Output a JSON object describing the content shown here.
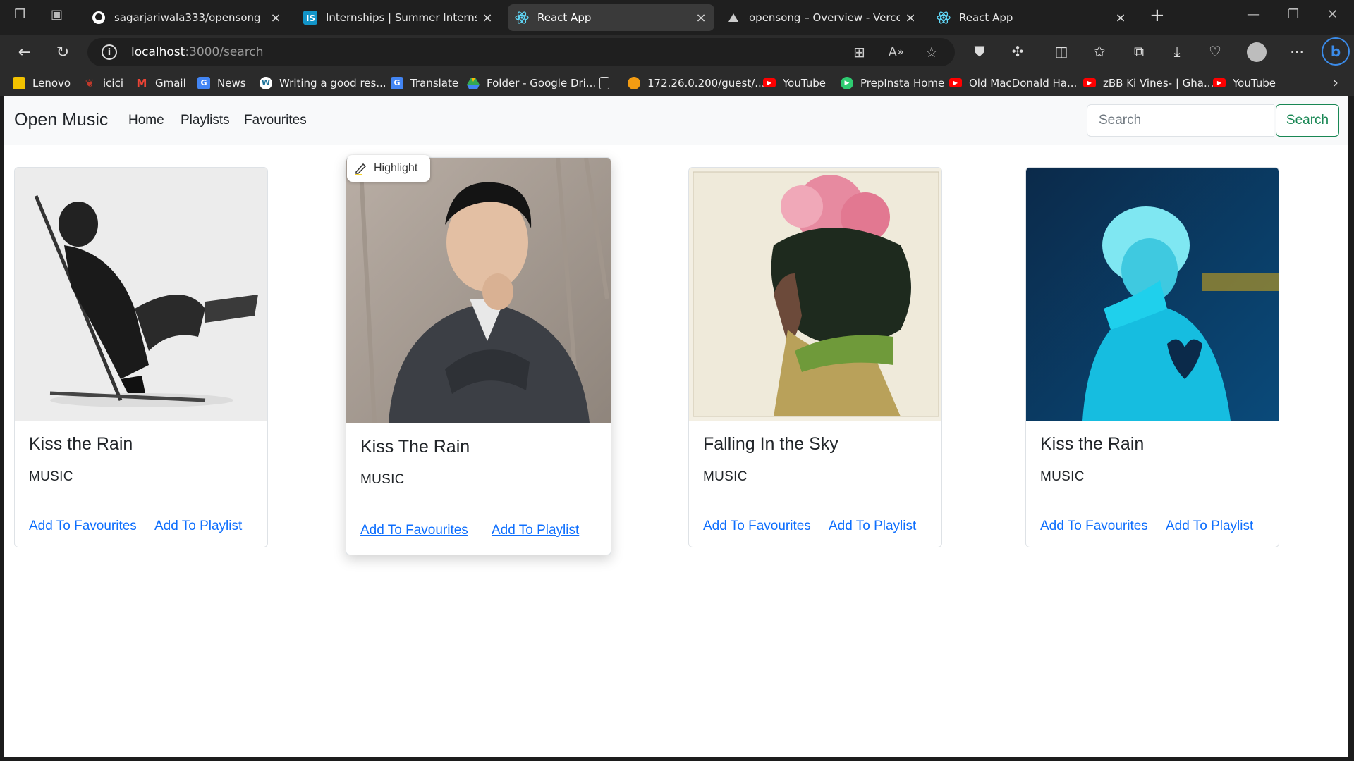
{
  "browser": {
    "tabs": [
      {
        "title": "sagarjariwala333/opensong",
        "icon": "github-icon"
      },
      {
        "title": "Internships | Summer Internship",
        "icon": "internshala-icon"
      },
      {
        "title": "React App",
        "icon": "react-icon",
        "active": true
      },
      {
        "title": "opensong – Overview - Vercel",
        "icon": "vercel-icon"
      },
      {
        "title": "React App",
        "icon": "react-icon"
      }
    ],
    "new_tab": "+",
    "url_host": "localhost",
    "url_path": ":3000/search",
    "bookmarks": [
      {
        "label": "Lenovo",
        "color": "#f2c200"
      },
      {
        "label": "icici",
        "color": "#c0392b"
      },
      {
        "label": "Gmail",
        "color": "#ea4335"
      },
      {
        "label": "News",
        "color": "#4285f4"
      },
      {
        "label": "Writing a good res...",
        "color": "#ffffff"
      },
      {
        "label": "Translate",
        "color": "#4285f4"
      },
      {
        "label": "Folder - Google Dri...",
        "color": "#34a853"
      },
      {
        "label": "",
        "color": "#dddddd"
      },
      {
        "label": "172.26.0.200/guest/...",
        "color": "#f39c12"
      },
      {
        "label": "YouTube",
        "color": "#ff0000"
      },
      {
        "label": "PrepInsta Home",
        "color": "#2ecc71"
      },
      {
        "label": "Old MacDonald Ha...",
        "color": "#ff0000"
      },
      {
        "label": "zBB Ki Vines- | Gha...",
        "color": "#ff0000"
      },
      {
        "label": "YouTube",
        "color": "#ff0000"
      }
    ]
  },
  "app": {
    "brand": "Open Music",
    "nav": [
      "Home",
      "Playlists",
      "Favourites"
    ],
    "search_placeholder": "Search",
    "search_button": "Search"
  },
  "highlight_label": "Highlight",
  "cards": [
    {
      "title": "Kiss the Rain",
      "subtitle": "MUSIC",
      "fav": "Add To Favourites",
      "playlist": "Add To Playlist"
    },
    {
      "title": "Kiss The Rain",
      "subtitle": "MUSIC",
      "fav": "Add To Favourites",
      "playlist": "Add To Playlist"
    },
    {
      "title": "Falling In the Sky",
      "subtitle": "MUSIC",
      "fav": "Add To Favourites",
      "playlist": "Add To Playlist"
    },
    {
      "title": "Kiss the Rain",
      "subtitle": "MUSIC",
      "fav": "Add To Favourites",
      "playlist": "Add To Playlist"
    }
  ],
  "colors": {
    "link": "#0d6efd",
    "search_btn": "#198754"
  }
}
